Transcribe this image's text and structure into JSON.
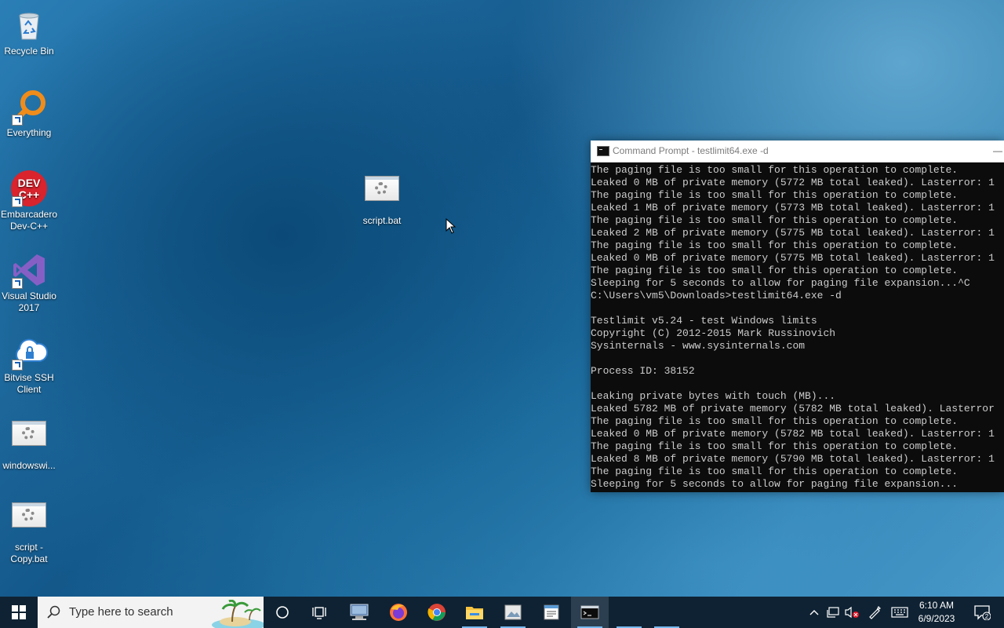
{
  "desktop": {
    "icons": [
      {
        "label": "Recycle Bin"
      },
      {
        "label": "Everything"
      },
      {
        "label": "Embarcadero Dev-C++"
      },
      {
        "label": "Visual Studio 2017"
      },
      {
        "label": "Bitvise SSH Client"
      },
      {
        "label": "windowswi..."
      },
      {
        "label": "script - Copy.bat"
      },
      {
        "label": "script.bat"
      }
    ]
  },
  "cmd": {
    "title": "Command Prompt - testlimit64.exe  -d",
    "lines": [
      "The paging file is too small for this operation to complete.",
      "Leaked 0 MB of private memory (5772 MB total leaked). Lasterror: 1",
      "The paging file is too small for this operation to complete.",
      "Leaked 1 MB of private memory (5773 MB total leaked). Lasterror: 1",
      "The paging file is too small for this operation to complete.",
      "Leaked 2 MB of private memory (5775 MB total leaked). Lasterror: 1",
      "The paging file is too small for this operation to complete.",
      "Leaked 0 MB of private memory (5775 MB total leaked). Lasterror: 1",
      "The paging file is too small for this operation to complete.",
      "Sleeping for 5 seconds to allow for paging file expansion...^C",
      "C:\\Users\\vm5\\Downloads>testlimit64.exe -d",
      "",
      "Testlimit v5.24 - test Windows limits",
      "Copyright (C) 2012-2015 Mark Russinovich",
      "Sysinternals - www.sysinternals.com",
      "",
      "Process ID: 38152",
      "",
      "Leaking private bytes with touch (MB)...",
      "Leaked 5782 MB of private memory (5782 MB total leaked). Lasterror",
      "The paging file is too small for this operation to complete.",
      "Leaked 0 MB of private memory (5782 MB total leaked). Lasterror: 1",
      "The paging file is too small for this operation to complete.",
      "Leaked 8 MB of private memory (5790 MB total leaked). Lasterror: 1",
      "The paging file is too small for this operation to complete.",
      "Sleeping for 5 seconds to allow for paging file expansion..."
    ]
  },
  "taskbar": {
    "search_placeholder": "Type here to search",
    "clock_time": "6:10 AM",
    "clock_date": "6/9/2023",
    "notification_count": "2",
    "apps": [
      {
        "icon": "cortana-icon"
      },
      {
        "icon": "task-view-icon"
      },
      {
        "icon": "network-app-icon"
      },
      {
        "icon": "firefox-icon"
      },
      {
        "icon": "chrome-icon"
      },
      {
        "icon": "file-explorer-icon"
      },
      {
        "icon": "image-app-icon"
      },
      {
        "icon": "notepad-icon"
      },
      {
        "icon": "command-prompt-icon"
      }
    ]
  },
  "colors": {
    "accent": "#76b9ed",
    "taskbar": "#0f2233",
    "console_bg": "#0c0c0c",
    "console_fg": "#cccccc"
  }
}
